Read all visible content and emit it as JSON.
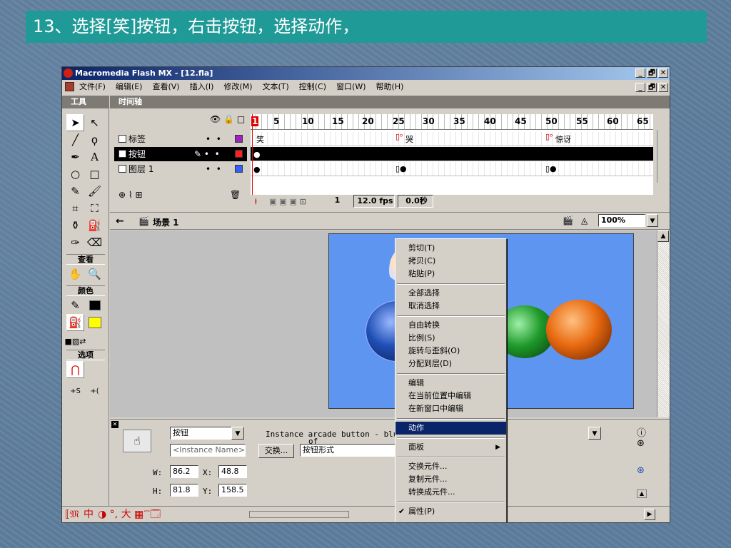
{
  "slide": {
    "title": "13、选择[笑]按钮，右击按钮，选择动作，"
  },
  "window": {
    "title": "Macromedia Flash MX - [12.fla]",
    "controls": [
      "_",
      "🗗",
      "✕"
    ]
  },
  "menubar": {
    "items": [
      "文件(F)",
      "编辑(E)",
      "查看(V)",
      "插入(I)",
      "修改(M)",
      "文本(T)",
      "控制(C)",
      "窗口(W)",
      "帮助(H)"
    ]
  },
  "tools": {
    "header": "工具",
    "view_label": "查看",
    "colors_label": "颜色",
    "options_label": "选项",
    "stroke_color": "#000000",
    "fill_color": "#ffff00"
  },
  "timeline": {
    "header": "时间轴",
    "layers": [
      {
        "name": "标签",
        "color": "#a020c0",
        "selected": false
      },
      {
        "name": "按钮",
        "color": "#ff2020",
        "selected": true
      },
      {
        "name": "图层 1",
        "color": "#3060ff",
        "selected": false
      }
    ],
    "ruler_numbers": [
      "1",
      "5",
      "10",
      "15",
      "20",
      "25",
      "30",
      "35",
      "40",
      "45",
      "50",
      "55",
      "60",
      "65"
    ],
    "frame_labels": {
      "smile": "笑",
      "cry": "哭",
      "surprise": "惊讶"
    },
    "current_frame": "1",
    "fps": "12.0 fps",
    "time": "0.0秒"
  },
  "stagebar": {
    "scene": "场景 1",
    "zoom": "100%"
  },
  "props": {
    "type_select": "按钮",
    "instance_placeholder": "<Instance Name>",
    "swap_button": "交换...",
    "instance_info": "Instance arcade button - blu",
    "instance_info2": "of",
    "behavior": "按钮形式",
    "w_label": "W:",
    "w_value": "86.2",
    "h_label": "H:",
    "h_value": "81.8",
    "x_label": "X:",
    "x_value": "48.8",
    "y_label": "Y:",
    "y_value": "158.5"
  },
  "statusbar": {
    "ime": "中",
    "ime_symbols": "◑ °, 大 ▦ ꙯ 🗔"
  },
  "context_menu": {
    "groups": [
      [
        "剪切(T)",
        "拷贝(C)",
        "粘贴(P)"
      ],
      [
        "全部选择",
        "取消选择"
      ],
      [
        "自由转换",
        "比例(S)",
        "旋转与歪斜(O)",
        "分配到层(D)"
      ],
      [
        "编辑",
        "在当前位置中编辑",
        "在新窗口中编辑"
      ],
      [
        "动作"
      ],
      [
        "面板"
      ],
      [
        "交换元件...",
        "复制元件...",
        "转换成元件..."
      ],
      [
        "属性(P)"
      ]
    ],
    "highlighted": "动作",
    "submenu_item": "面板",
    "checked_item": "属性(P)"
  },
  "colors": {
    "button_blue": "#1f4fb5",
    "button_green": "#1f9a2a",
    "button_orange": "#e86a10",
    "stage_bg": "#5d95f0"
  }
}
